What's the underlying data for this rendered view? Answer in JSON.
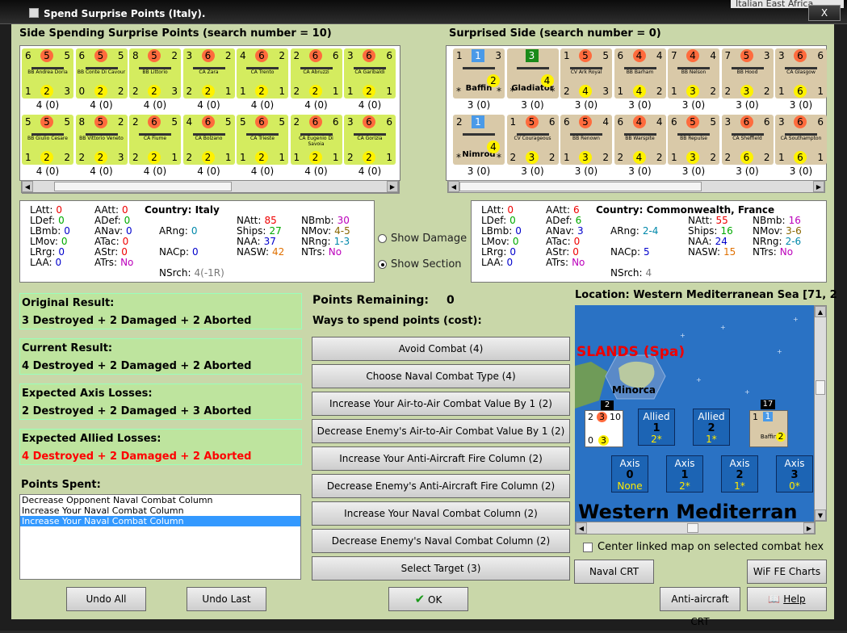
{
  "window": {
    "title": "Spend Surprise Points (Italy).",
    "behind_text": "Italian East Africa",
    "close_label": "X"
  },
  "left_panel": {
    "title": "Side Spending Surprise Points (search number = 10)",
    "counters": [
      {
        "tl": "6",
        "tm": "5",
        "tr": "5",
        "name": "BB Andrea Doria",
        "bl": "1",
        "bm": "2",
        "br": "3",
        "below": "4 (0)"
      },
      {
        "tl": "6",
        "tm": "5",
        "tr": "5",
        "name": "BB Conte Di Cavour",
        "bl": "0",
        "bm": "2",
        "br": "2",
        "below": "4 (0)"
      },
      {
        "tl": "8",
        "tm": "5",
        "tr": "2",
        "name": "BB Littorio",
        "bl": "2",
        "bm": "2",
        "br": "3",
        "below": "4 (0)"
      },
      {
        "tl": "3",
        "tm": "6",
        "tr": "2",
        "name": "CA Zara",
        "bl": "2",
        "bm": "2",
        "br": "1",
        "below": "4 (0)"
      },
      {
        "tl": "4",
        "tm": "6",
        "tr": "2",
        "name": "CA Trento",
        "bl": "1",
        "bm": "2",
        "br": "1",
        "below": "4 (0)"
      },
      {
        "tl": "2",
        "tm": "6",
        "tr": "6",
        "name": "CA Abruzzi",
        "bl": "2",
        "bm": "2",
        "br": "1",
        "below": "4 (0)"
      },
      {
        "tl": "3",
        "tm": "6",
        "tr": "6",
        "name": "CA Garibaldi",
        "bl": "1",
        "bm": "2",
        "br": "1",
        "below": "4 (0)"
      },
      {
        "tl": "5",
        "tm": "5",
        "tr": "5",
        "name": "BB Giulio Cesare",
        "bl": "1",
        "bm": "2",
        "br": "2",
        "below": "4 (0)"
      },
      {
        "tl": "8",
        "tm": "5",
        "tr": "2",
        "name": "BB Vittorio Veneto",
        "bl": "2",
        "bm": "2",
        "br": "3",
        "below": "4 (0)"
      },
      {
        "tl": "2",
        "tm": "6",
        "tr": "5",
        "name": "CA Fiume",
        "bl": "2",
        "bm": "2",
        "br": "1",
        "below": "4 (0)"
      },
      {
        "tl": "4",
        "tm": "6",
        "tr": "5",
        "name": "CA Bolzano",
        "bl": "2",
        "bm": "2",
        "br": "1",
        "below": "4 (0)"
      },
      {
        "tl": "5",
        "tm": "6",
        "tr": "5",
        "name": "CA Trieste",
        "bl": "1",
        "bm": "2",
        "br": "1",
        "below": "4 (0)"
      },
      {
        "tl": "2",
        "tm": "6",
        "tr": "6",
        "name": "CA Eugenio Di Savoia",
        "bl": "1",
        "bm": "2",
        "br": "1",
        "below": "4 (0)"
      },
      {
        "tl": "3",
        "tm": "6",
        "tr": "6",
        "name": "CA Gorizia",
        "bl": "2",
        "bm": "2",
        "br": "1",
        "below": "4 (0)"
      }
    ]
  },
  "right_panel": {
    "title": "Surprised Side (search number = 0)",
    "counters": [
      {
        "tl": "1",
        "tm": "1",
        "tr": "3",
        "name": "Baffin",
        "bl": "*",
        "bm": "2",
        "br": "*",
        "below": "3 (0)",
        "air": true
      },
      {
        "tl": "",
        "tm": "3",
        "tr": "",
        "name": "Gladiator",
        "bl": "*",
        "bm": "4",
        "br": "*",
        "below": "3 (0)",
        "air": true
      },
      {
        "tl": "1",
        "tm": "5",
        "tr": "5",
        "name": "CV Ark Royal",
        "bl": "2",
        "bm": "4",
        "br": "3",
        "below": "3 (0)"
      },
      {
        "tl": "6",
        "tm": "4",
        "tr": "4",
        "name": "BB Barham",
        "bl": "1",
        "bm": "4",
        "br": "2",
        "below": "3 (0)"
      },
      {
        "tl": "7",
        "tm": "4",
        "tr": "4",
        "name": "BB Nelson",
        "bl": "1",
        "bm": "3",
        "br": "2",
        "below": "3 (0)"
      },
      {
        "tl": "7",
        "tm": "5",
        "tr": "3",
        "name": "BB Hood",
        "bl": "2",
        "bm": "3",
        "br": "2",
        "below": "3 (0)"
      },
      {
        "tl": "3",
        "tm": "6",
        "tr": "6",
        "name": "CA Glasgow",
        "bl": "1",
        "bm": "6",
        "br": "1",
        "below": "3 (0)"
      },
      {
        "tl": "2",
        "tm": "1",
        "tr": "",
        "name": "Nimrod",
        "bl": "*",
        "bm": "4",
        "br": "*",
        "below": "3 (0)",
        "air": true
      },
      {
        "tl": "1",
        "tm": "5",
        "tr": "6",
        "name": "CV Courageous",
        "bl": "2",
        "bm": "3",
        "br": "2",
        "below": "3 (0)"
      },
      {
        "tl": "6",
        "tm": "5",
        "tr": "4",
        "name": "BB Renown",
        "bl": "1",
        "bm": "3",
        "br": "2",
        "below": "3 (0)"
      },
      {
        "tl": "6",
        "tm": "4",
        "tr": "4",
        "name": "BB Warspite",
        "bl": "2",
        "bm": "4",
        "br": "2",
        "below": "3 (0)"
      },
      {
        "tl": "6",
        "tm": "5",
        "tr": "5",
        "name": "BB Repulse",
        "bl": "1",
        "bm": "3",
        "br": "2",
        "below": "3 (0)"
      },
      {
        "tl": "3",
        "tm": "6",
        "tr": "6",
        "name": "CA Sheffield",
        "bl": "2",
        "bm": "6",
        "br": "2",
        "below": "3 (0)"
      },
      {
        "tl": "3",
        "tm": "6",
        "tr": "6",
        "name": "CA Southampton",
        "bl": "1",
        "bm": "6",
        "br": "1",
        "below": "3 (0)"
      }
    ]
  },
  "left_stats": {
    "country_label": "Country: Italy",
    "col1": [
      [
        "LAtt:",
        "0",
        "red"
      ],
      [
        "LDef:",
        "0",
        "green"
      ],
      [
        "LBmb:",
        "0",
        "blue"
      ],
      [
        "LMov:",
        "0",
        "green"
      ],
      [
        "LRrg:",
        "0",
        "blue"
      ],
      [
        "LAA:",
        "0",
        "blue"
      ]
    ],
    "col2": [
      [
        "AAtt:",
        "0",
        "red"
      ],
      [
        "ADef:",
        "0",
        "green"
      ],
      [
        "ANav:",
        "0",
        "blue"
      ],
      [
        "ATac:",
        "0",
        "red"
      ],
      [
        "AStr:",
        "0",
        "red"
      ],
      [
        "ATrs:",
        "No",
        "purple"
      ]
    ],
    "col3": [
      [
        "ARng:",
        "0",
        "teal"
      ],
      [
        "NACp:",
        "0",
        "blue"
      ],
      [
        "NSrch:",
        "4(-1R)",
        "gray"
      ]
    ],
    "col4": [
      [
        "NAtt:",
        "85",
        "red"
      ],
      [
        "Ships:",
        "27",
        "green"
      ],
      [
        "NAA:",
        "37",
        "blue"
      ],
      [
        "NASW:",
        "42",
        "orange"
      ]
    ],
    "col5": [
      [
        "NBmb:",
        "30",
        "purple"
      ],
      [
        "NMov:",
        "4-5",
        "olive"
      ],
      [
        "NRng:",
        "1-3",
        "teal"
      ],
      [
        "NTrs:",
        "No",
        "purple"
      ]
    ]
  },
  "right_stats": {
    "country_label": "Country: Commonwealth, France",
    "col1": [
      [
        "LAtt:",
        "0",
        "red"
      ],
      [
        "LDef:",
        "0",
        "green"
      ],
      [
        "LBmb:",
        "0",
        "blue"
      ],
      [
        "LMov:",
        "0",
        "green"
      ],
      [
        "LRrg:",
        "0",
        "blue"
      ],
      [
        "LAA:",
        "0",
        "blue"
      ]
    ],
    "col2": [
      [
        "AAtt:",
        "6",
        "red"
      ],
      [
        "ADef:",
        "6",
        "green"
      ],
      [
        "ANav:",
        "3",
        "blue"
      ],
      [
        "ATac:",
        "0",
        "red"
      ],
      [
        "AStr:",
        "0",
        "red"
      ],
      [
        "ATrs:",
        "No",
        "purple"
      ]
    ],
    "col3": [
      [
        "ARng:",
        "2-4",
        "teal"
      ],
      [
        "NACp:",
        "5",
        "blue"
      ],
      [
        "NSrch:",
        "4",
        "gray"
      ]
    ],
    "col4": [
      [
        "NAtt:",
        "55",
        "red"
      ],
      [
        "Ships:",
        "16",
        "green"
      ],
      [
        "NAA:",
        "24",
        "blue"
      ],
      [
        "NASW:",
        "15",
        "orange"
      ]
    ],
    "col5": [
      [
        "NBmb:",
        "16",
        "purple"
      ],
      [
        "NMov:",
        "3-6",
        "olive"
      ],
      [
        "NRng:",
        "2-6",
        "teal"
      ],
      [
        "NTrs:",
        "No",
        "purple"
      ]
    ]
  },
  "options": {
    "show_damage": "Show Damage",
    "show_section": "Show Section"
  },
  "results": [
    {
      "heading": "Original Result:",
      "text": "3 Destroyed + 2 Damaged + 2 Aborted",
      "red": false
    },
    {
      "heading": "Current Result:",
      "text": "4 Destroyed + 2 Damaged + 2 Aborted",
      "red": false
    },
    {
      "heading": "Expected Axis Losses:",
      "text": "2 Destroyed + 2 Damaged + 3 Aborted",
      "red": false
    },
    {
      "heading": "Expected Allied Losses:",
      "text": "4 Destroyed + 2 Damaged + 2 Aborted",
      "red": true
    }
  ],
  "points_spent": {
    "label": "Points Spent:",
    "items": [
      {
        "text": "Decrease Opponent Naval Combat Column",
        "selected": false
      },
      {
        "text": "Increase Your Naval Combat Column",
        "selected": false
      },
      {
        "text": "Increase Your Naval Combat Column",
        "selected": true
      }
    ]
  },
  "spend": {
    "remaining_label": "Points Remaining:",
    "remaining_value": "0",
    "ways_label": "Ways to spend points (cost):",
    "options": [
      "Avoid Combat (4)",
      "Choose Naval Combat Type (4)",
      "Increase Your Air-to-Air Combat Value By 1 (2)",
      "Decrease Enemy's Air-to-Air Combat Value By 1 (2)",
      "Increase Your Anti-Aircraft Fire Column (2)",
      "Decrease Enemy's Anti-Aircraft Fire Column (2)",
      "Increase Your Naval Combat Column (2)",
      "Decrease Enemy's Naval Combat Column (2)",
      "Select Target (3)"
    ]
  },
  "map": {
    "location": "Location: Western Mediterranean Sea [71, 2",
    "islands_label": "SLANDS (Spa)",
    "minorca": "Minorca",
    "sea_label": "Western Mediterran",
    "stack_left_count": "2",
    "stack_right_count": "17",
    "stack_left": {
      "tl": "2",
      "tm": "3",
      "tr": "10",
      "bl": "0",
      "bm": "3",
      "br": ""
    },
    "stack_right": {
      "tl": "1",
      "tm": "1",
      "tr": "",
      "name": "Baffin",
      "bl": "",
      "bm": "2",
      "br": ""
    },
    "allied_boxes": [
      {
        "a": "Allied",
        "b": "1",
        "c": "2*"
      },
      {
        "a": "Allied",
        "b": "2",
        "c": "1*"
      }
    ],
    "axis_boxes": [
      {
        "a": "Axis",
        "b": "0",
        "c": "None"
      },
      {
        "a": "Axis",
        "b": "1",
        "c": "2*"
      },
      {
        "a": "Axis",
        "b": "2",
        "c": "1*"
      },
      {
        "a": "Axis",
        "b": "3",
        "c": "0*"
      }
    ],
    "checkbox_label": "Center linked map on selected combat hex"
  },
  "buttons": {
    "undo_all": "Undo All",
    "undo_last": "Undo Last",
    "ok": "OK",
    "naval_crt": "Naval CRT",
    "wif_fe_charts": "WiF FE Charts",
    "aa_crt": "Anti-aircraft CRT",
    "help": "Help"
  }
}
